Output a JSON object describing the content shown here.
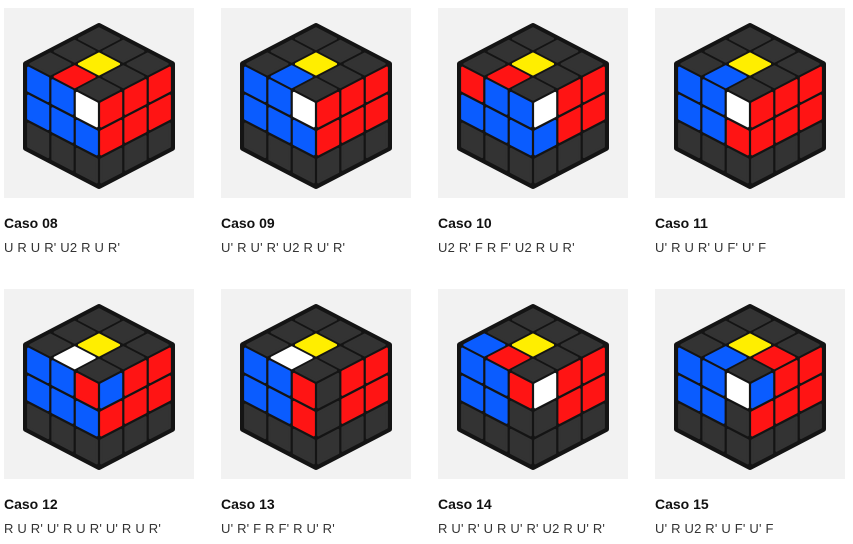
{
  "colors": {
    "dark": "#333333",
    "yellow": "#ffee00",
    "blue": "#0a5cff",
    "red": "#ff1414",
    "white": "#ffffff",
    "outline": "#141414",
    "thumb_bg": "#f2f2f2"
  },
  "cases": [
    {
      "title": "Caso 08",
      "algorithm": "U R U R' U2 R U R'",
      "top": [
        "D",
        "D",
        "D",
        "D",
        "Y",
        "D",
        "D",
        "R",
        "D"
      ],
      "left": [
        "B",
        "B",
        "W",
        "B",
        "B",
        "B",
        "D",
        "D",
        "D"
      ],
      "right": [
        "R",
        "R",
        "R",
        "R",
        "R",
        "R",
        "D",
        "D",
        "D"
      ]
    },
    {
      "title": "Caso 09",
      "algorithm": "U' R U' R' U2 R U' R'",
      "top": [
        "D",
        "D",
        "D",
        "D",
        "Y",
        "D",
        "D",
        "B",
        "D"
      ],
      "left": [
        "B",
        "B",
        "W",
        "B",
        "B",
        "B",
        "D",
        "D",
        "D"
      ],
      "right": [
        "R",
        "R",
        "R",
        "R",
        "R",
        "R",
        "D",
        "D",
        "D"
      ]
    },
    {
      "title": "Caso 10",
      "algorithm": "U2 R' F R F' U2 R U R'",
      "top": [
        "D",
        "D",
        "D",
        "D",
        "Y",
        "D",
        "D",
        "R",
        "D"
      ],
      "left": [
        "R",
        "B",
        "B",
        "B",
        "B",
        "B",
        "D",
        "D",
        "D"
      ],
      "right": [
        "W",
        "R",
        "R",
        "B",
        "R",
        "R",
        "D",
        "D",
        "D"
      ]
    },
    {
      "title": "Caso 11",
      "algorithm": "U' R U R' U F' U' F",
      "top": [
        "D",
        "D",
        "D",
        "D",
        "Y",
        "D",
        "D",
        "B",
        "D"
      ],
      "left": [
        "B",
        "B",
        "W",
        "B",
        "B",
        "R",
        "D",
        "D",
        "D"
      ],
      "right": [
        "R",
        "R",
        "R",
        "R",
        "R",
        "R",
        "D",
        "D",
        "D"
      ]
    },
    {
      "title": "Caso 12",
      "algorithm": "R U R' U' R U R' U' R U R'",
      "top": [
        "D",
        "D",
        "D",
        "D",
        "Y",
        "D",
        "D",
        "W",
        "D"
      ],
      "left": [
        "B",
        "B",
        "R",
        "B",
        "B",
        "B",
        "D",
        "D",
        "D"
      ],
      "right": [
        "B",
        "R",
        "R",
        "R",
        "R",
        "R",
        "D",
        "D",
        "D"
      ]
    },
    {
      "title": "Caso 13",
      "algorithm": "U' R' F R F' R U' R'",
      "top": [
        "D",
        "D",
        "D",
        "D",
        "Y",
        "D",
        "D",
        "W",
        "D"
      ],
      "left": [
        "B",
        "B",
        "R",
        "B",
        "B",
        "R",
        "D",
        "D",
        "D"
      ],
      "right": [
        "D",
        "R",
        "R",
        "D",
        "R",
        "R",
        "D",
        "D",
        "D"
      ]
    },
    {
      "title": "Caso 14",
      "algorithm": "R U' R' U R U' R' U2 R U' R'",
      "top": [
        "D",
        "D",
        "D",
        "D",
        "Y",
        "D",
        "B",
        "R",
        "D"
      ],
      "left": [
        "B",
        "B",
        "R",
        "B",
        "B",
        "D",
        "D",
        "D",
        "D"
      ],
      "right": [
        "W",
        "R",
        "R",
        "D",
        "R",
        "R",
        "D",
        "D",
        "D"
      ]
    },
    {
      "title": "Caso 15",
      "algorithm": "U' R U2 R' U F' U' F",
      "top": [
        "D",
        "D",
        "D",
        "D",
        "Y",
        "R",
        "D",
        "B",
        "D"
      ],
      "left": [
        "B",
        "B",
        "W",
        "B",
        "B",
        "D",
        "D",
        "D",
        "D"
      ],
      "right": [
        "B",
        "R",
        "R",
        "R",
        "R",
        "R",
        "D",
        "D",
        "D"
      ]
    }
  ]
}
